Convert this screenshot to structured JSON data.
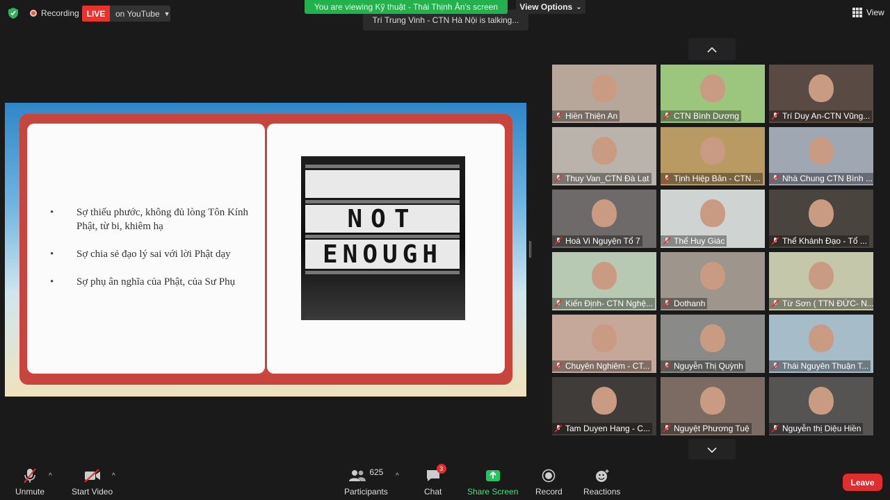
{
  "topbar": {
    "recording_label": "Recording",
    "live_label": "LIVE",
    "stream_target": "on YouTube",
    "viewing_banner": "You are viewing Kỹ thuật - Thái Thịnh Ân's screen",
    "view_options_label": "View Options",
    "talking_indicator": "Trí Trung Vinh - CTN Hà Nội is talking...",
    "view_label": "View"
  },
  "slide": {
    "bullets": [
      "Sợ thiếu phước, không đủ lòng Tôn Kính Phật, từ bi, khiêm hạ",
      "Sợ chia sẻ đạo lý sai với lời Phật dạy",
      "Sợ phụ ân nghĩa của Phật, của Sư Phụ"
    ],
    "lightbox_line1": "NOT",
    "lightbox_line2": "ENOUGH"
  },
  "participants": [
    {
      "name": "Hiền Thiện An",
      "bg": "#b7a79a"
    },
    {
      "name": "CTN Bình Dương",
      "bg": "#9cc57e"
    },
    {
      "name": "Trí Duy An-CTN Vũng...",
      "bg": "#5a4a44"
    },
    {
      "name": "Thuy Van_CTN Đà Lạt",
      "bg": "#b9b3ab"
    },
    {
      "name": "Tịnh Hiệp Bản - CTN ...",
      "bg": "#b89a62"
    },
    {
      "name": "Nhà Chung CTN Bình ...",
      "bg": "#9fa7b2"
    },
    {
      "name": "Hoà Vi Nguyện Tổ 7",
      "bg": "#6d6a69"
    },
    {
      "name": "Thể Huy Giác",
      "bg": "#cfd3d2"
    },
    {
      "name": "Thể Khánh Đạo - Tổ ...",
      "bg": "#4a443e"
    },
    {
      "name": "Kiến Định- CTN Nghệ...",
      "bg": "#b8c9b3"
    },
    {
      "name": "Dothanh",
      "bg": "#9e958c"
    },
    {
      "name": "Từ Sơn ( TTN ĐỨC- N...",
      "bg": "#c4c7aa"
    },
    {
      "name": "Chuyên Nghiêm - CT...",
      "bg": "#c5a89a"
    },
    {
      "name": "Nguyễn Thị Quỳnh",
      "bg": "#8a8a88"
    },
    {
      "name": "Thái Nguyên Thuận T...",
      "bg": "#a7bcc9"
    },
    {
      "name": "Tam Duyen Hang - C...",
      "bg": "#403c3a"
    },
    {
      "name": "Nguyệt Phương Tuệ",
      "bg": "#7c6b62"
    },
    {
      "name": "Nguyễn thị Diệu Hiền",
      "bg": "#565453"
    }
  ],
  "toolbar": {
    "unmute": "Unmute",
    "start_video": "Start Video",
    "participants": "Participants",
    "participant_count": "625",
    "chat": "Chat",
    "chat_badge": "3",
    "share_screen": "Share Screen",
    "record": "Record",
    "reactions": "Reactions",
    "leave": "Leave"
  },
  "colors": {
    "accent_green": "#22b14c",
    "live_red": "#e7332b",
    "leave_red": "#e02d2d",
    "share_screen_green": "#22c55e"
  }
}
